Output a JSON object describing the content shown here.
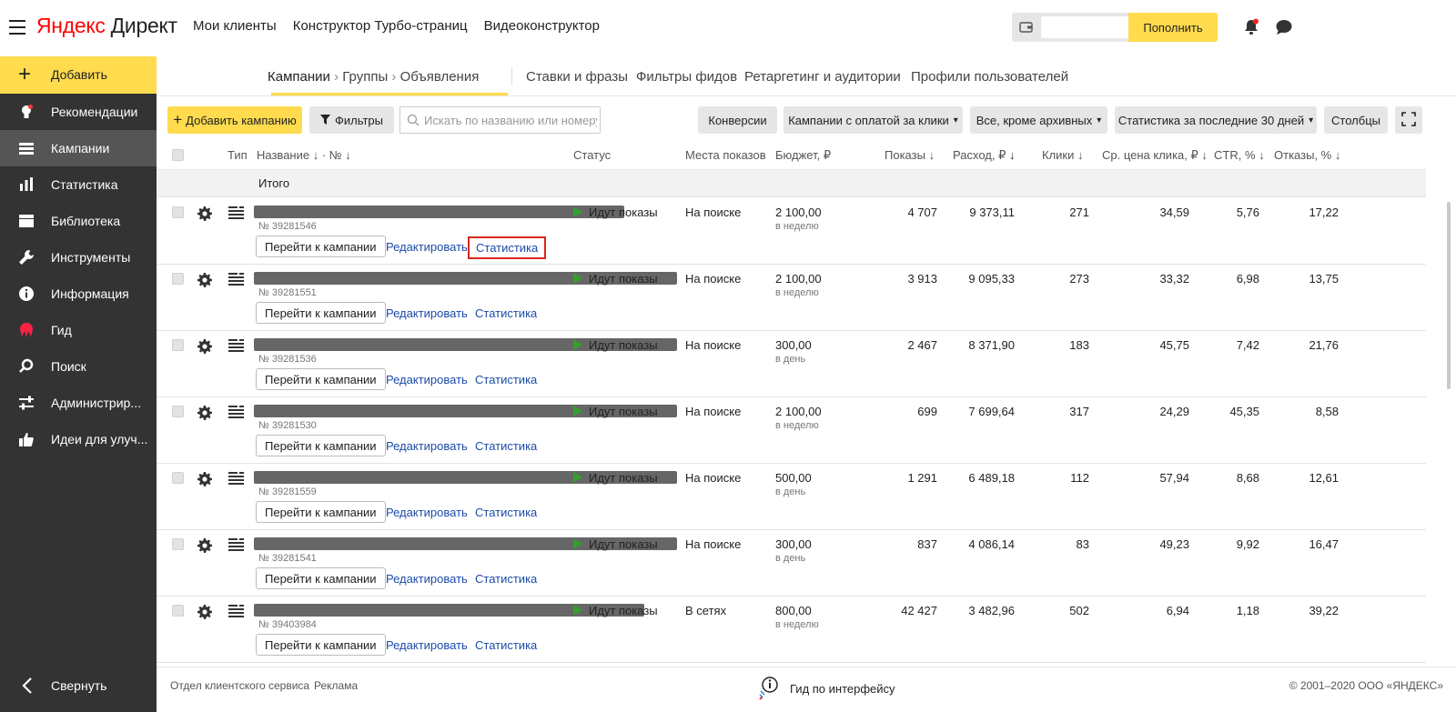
{
  "header": {
    "logo_brand": "Яндекс",
    "logo_product": "Директ",
    "nav": [
      "Мои клиенты",
      "Конструктор Турбо-страниц",
      "Видеоконструктор"
    ],
    "topup_label": "Пополнить"
  },
  "sidebar": {
    "add_label": "Добавить",
    "items": [
      {
        "label": "Рекомендации",
        "icon": "lightbulb-icon"
      },
      {
        "label": "Кампании",
        "icon": "list-icon",
        "active": true
      },
      {
        "label": "Статистика",
        "icon": "bar-chart-icon"
      },
      {
        "label": "Библиотека",
        "icon": "library-icon"
      },
      {
        "label": "Инструменты",
        "icon": "wrench-icon"
      },
      {
        "label": "Информация",
        "icon": "info-icon"
      },
      {
        "label": "Гид",
        "icon": "guide-icon"
      },
      {
        "label": "Поиск",
        "icon": "search-icon"
      },
      {
        "label": "Администрир...",
        "icon": "sliders-icon"
      },
      {
        "label": "Идеи для улуч...",
        "icon": "thumbs-up-icon"
      }
    ],
    "collapse_label": "Свернуть"
  },
  "tabs": {
    "crumbs": [
      "Кампании",
      "Группы",
      "Объявления"
    ],
    "items": [
      "Ставки и фразы",
      "Фильтры фидов",
      "Ретаргетинг и аудитории",
      "Профили пользователей"
    ]
  },
  "toolbar": {
    "add_campaign": "Добавить кампанию",
    "filters": "Фильтры",
    "search_placeholder": "Искать по названию или номеру",
    "conversions": "Конверсии",
    "payment": "Кампании с оплатой за клики",
    "archive": "Все, кроме архивных",
    "period": "Статистика за последние 30 дней",
    "columns": "Столбцы"
  },
  "table": {
    "headers": {
      "type": "Тип",
      "name": "Название",
      "no": "№",
      "status": "Статус",
      "places": "Места показов",
      "budget": "Бюджет, ₽",
      "impressions": "Показы",
      "cost": "Расход, ₽",
      "clicks": "Клики",
      "cpc": "Ср. цена клика, ₽",
      "ctr": "CTR, %",
      "bounce": "Отказы, %"
    },
    "total_label": "Итого",
    "goto_label": "Перейти к кампании",
    "edit_label": "Редактировать",
    "stat_label": "Статистика",
    "rows": [
      {
        "num": "№ 39281546",
        "status": "Идут показы",
        "place": "На поиске",
        "budget": "2 100,00",
        "period": "в неделю",
        "impressions": "4 707",
        "cost": "9 373,11",
        "clicks": "271",
        "cpc": "34,59",
        "ctr": "5,76",
        "bounce": "17,22"
      },
      {
        "num": "№ 39281551",
        "status": "Идут показы",
        "place": "На поиске",
        "budget": "2 100,00",
        "period": "в неделю",
        "impressions": "3 913",
        "cost": "9 095,33",
        "clicks": "273",
        "cpc": "33,32",
        "ctr": "6,98",
        "bounce": "13,75"
      },
      {
        "num": "№ 39281536",
        "status": "Идут показы",
        "place": "На поиске",
        "budget": "300,00",
        "period": "в день",
        "impressions": "2 467",
        "cost": "8 371,90",
        "clicks": "183",
        "cpc": "45,75",
        "ctr": "7,42",
        "bounce": "21,76"
      },
      {
        "num": "№ 39281530",
        "status": "Идут показы",
        "place": "На поиске",
        "budget": "2 100,00",
        "period": "в неделю",
        "impressions": "699",
        "cost": "7 699,64",
        "clicks": "317",
        "cpc": "24,29",
        "ctr": "45,35",
        "bounce": "8,58"
      },
      {
        "num": "№ 39281559",
        "status": "Идут показы",
        "place": "На поиске",
        "budget": "500,00",
        "period": "в день",
        "impressions": "1 291",
        "cost": "6 489,18",
        "clicks": "112",
        "cpc": "57,94",
        "ctr": "8,68",
        "bounce": "12,61"
      },
      {
        "num": "№ 39281541",
        "status": "Идут показы",
        "place": "На поиске",
        "budget": "300,00",
        "period": "в день",
        "impressions": "837",
        "cost": "4 086,14",
        "clicks": "83",
        "cpc": "49,23",
        "ctr": "9,92",
        "bounce": "16,47"
      },
      {
        "num": "№ 39403984",
        "status": "Идут показы",
        "place": "В сетях",
        "budget": "800,00",
        "period": "в неделю",
        "impressions": "42 427",
        "cost": "3 482,96",
        "clicks": "502",
        "cpc": "6,94",
        "ctr": "1,18",
        "bounce": "39,22"
      }
    ]
  },
  "footer": {
    "client_service": "Отдел клиентского сервиса",
    "ads": "Реклама",
    "guide": "Гид по интерфейсу",
    "copyright": "© 2001–2020 ООО «ЯНДЕКС»"
  },
  "colors": {
    "accent": "#ffdb4d",
    "sidebar": "#333333",
    "link": "#1c4ba8",
    "status_ok": "#33a02c",
    "highlight": "#d9261c"
  }
}
